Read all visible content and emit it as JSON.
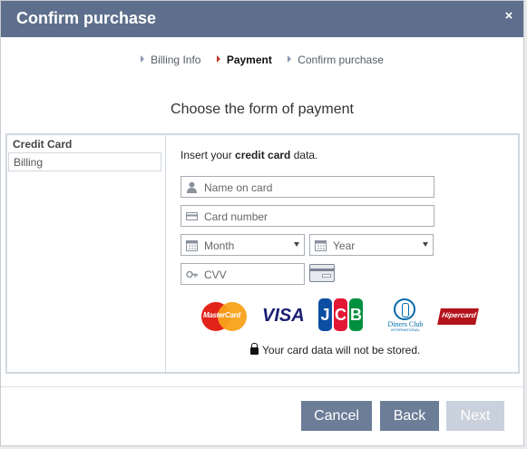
{
  "dialog": {
    "title": "Confirm purchase",
    "close_glyph": "×"
  },
  "steps": [
    {
      "label": "Billing Info",
      "active": false
    },
    {
      "label": "Payment",
      "active": true
    },
    {
      "label": "Confirm purchase",
      "active": false
    }
  ],
  "heading": "Choose the form of payment",
  "sidebar": {
    "section_title": "Credit Card",
    "items": [
      {
        "label": "Billing"
      }
    ]
  },
  "form": {
    "intro_prefix": "Insert your ",
    "intro_bold": "credit card",
    "intro_suffix": " data.",
    "name_placeholder": "Name on card",
    "number_placeholder": "Card number",
    "month_placeholder": "Month",
    "year_placeholder": "Year",
    "cvv_placeholder": "CVV"
  },
  "card_brands": {
    "mastercard": "MasterCard",
    "visa": "VISA",
    "jcb": [
      "J",
      "C",
      "B"
    ],
    "diners": "Diners Club",
    "diners_sub": "INTERNATIONAL",
    "hipercard": "Hipercard"
  },
  "notice": "Your card data will not be stored.",
  "buttons": {
    "cancel": "Cancel",
    "back": "Back",
    "next": "Next"
  },
  "colors": {
    "header_bg": "#5d6f8c",
    "button_bg": "#6c7d98",
    "button_disabled_bg": "#c9d1dd",
    "active_step_marker": "#c0392b"
  }
}
